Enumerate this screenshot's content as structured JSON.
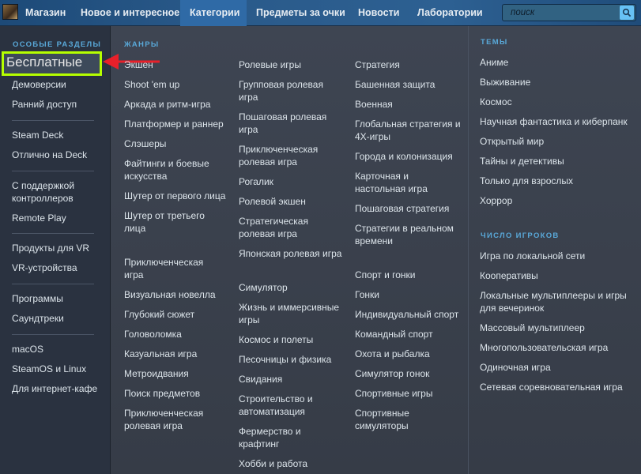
{
  "nav": {
    "items": [
      "Магазин",
      "Новое и интересное",
      "Категории",
      "Предметы за очки",
      "Новости",
      "Лаборатории"
    ],
    "active": "Категории",
    "search_placeholder": "поиск",
    "avatar_icon": "user-avatar"
  },
  "sidebar": {
    "heading": "ОСОБЫЕ РАЗДЕЛЫ",
    "free": "Бесплатные",
    "group1": [
      "Демоверсии",
      "Ранний доступ"
    ],
    "group2": [
      "Steam Deck",
      "Отлично на Deck"
    ],
    "group3": [
      "С поддержкой контроллеров",
      "Remote Play"
    ],
    "group4": [
      "Продукты для VR",
      "VR-устройства"
    ],
    "group5": [
      "Программы",
      "Саундтреки"
    ],
    "group6": [
      "macOS",
      "SteamOS и Linux",
      "Для интернет-кафе"
    ]
  },
  "genres": {
    "heading": "ЖАНРЫ",
    "col1_a": [
      "Экшен",
      "Shoot 'em up",
      "Аркада и ритм-игра",
      "Платформер и раннер",
      "Слэшеры",
      "Файтинги и боевые искусства",
      "Шутер от первого лица",
      "Шутер от третьего лица"
    ],
    "col1_b": [
      "Приключенческая игра",
      "Визуальная новелла",
      "Глубокий сюжет",
      "Головоломка",
      "Казуальная игра",
      "Метроидвания",
      "Поиск предметов",
      "Приключенческая ролевая игра"
    ],
    "col2_a": [
      "Ролевые игры",
      "Групповая ролевая игра",
      "Пошаговая ролевая игра",
      "Приключенческая ролевая игра",
      "Рогалик",
      "Ролевой экшен",
      "Стратегическая ролевая игра",
      "Японская ролевая игра"
    ],
    "col2_b": [
      "Симулятор",
      "Жизнь и иммерсивные игры",
      "Космос и полеты",
      "Песочницы и физика",
      "Свидания",
      "Строительство и автоматизация",
      "Фермерство и крафтинг",
      "Хобби и работа"
    ],
    "col3_a": [
      "Стратегия",
      "Башенная защита",
      "Военная",
      "Глобальная стратегия и 4X-игры",
      "Города и колонизация",
      "Карточная и настольная игра",
      "Пошаговая стратегия",
      "Стратегии в реальном времени"
    ],
    "col3_b": [
      "Спорт и гонки",
      "Гонки",
      "Индивидуальный спорт",
      "Командный спорт",
      "Охота и рыбалка",
      "Симулятор гонок",
      "Спортивные игры",
      "Спортивные симуляторы"
    ]
  },
  "themes": {
    "heading": "ТЕМЫ",
    "items": [
      "Аниме",
      "Выживание",
      "Космос",
      "Научная фантастика и киберпанк",
      "Открытый мир",
      "Тайны и детективы",
      "Только для взрослых",
      "Хоррор"
    ]
  },
  "players": {
    "heading": "ЧИСЛО ИГРОКОВ",
    "items": [
      "Игра по локальной сети",
      "Кооперативы",
      "Локальные мультиплееры и игры для вечеринок",
      "Массовый мультиплеер",
      "Многопользовательская игра",
      "Одиночная игра",
      "Сетевая соревновательная игра"
    ]
  },
  "colors": {
    "accent": "#59a8d8",
    "highlight": "#b6ff00",
    "arrow": "#e8202a"
  }
}
